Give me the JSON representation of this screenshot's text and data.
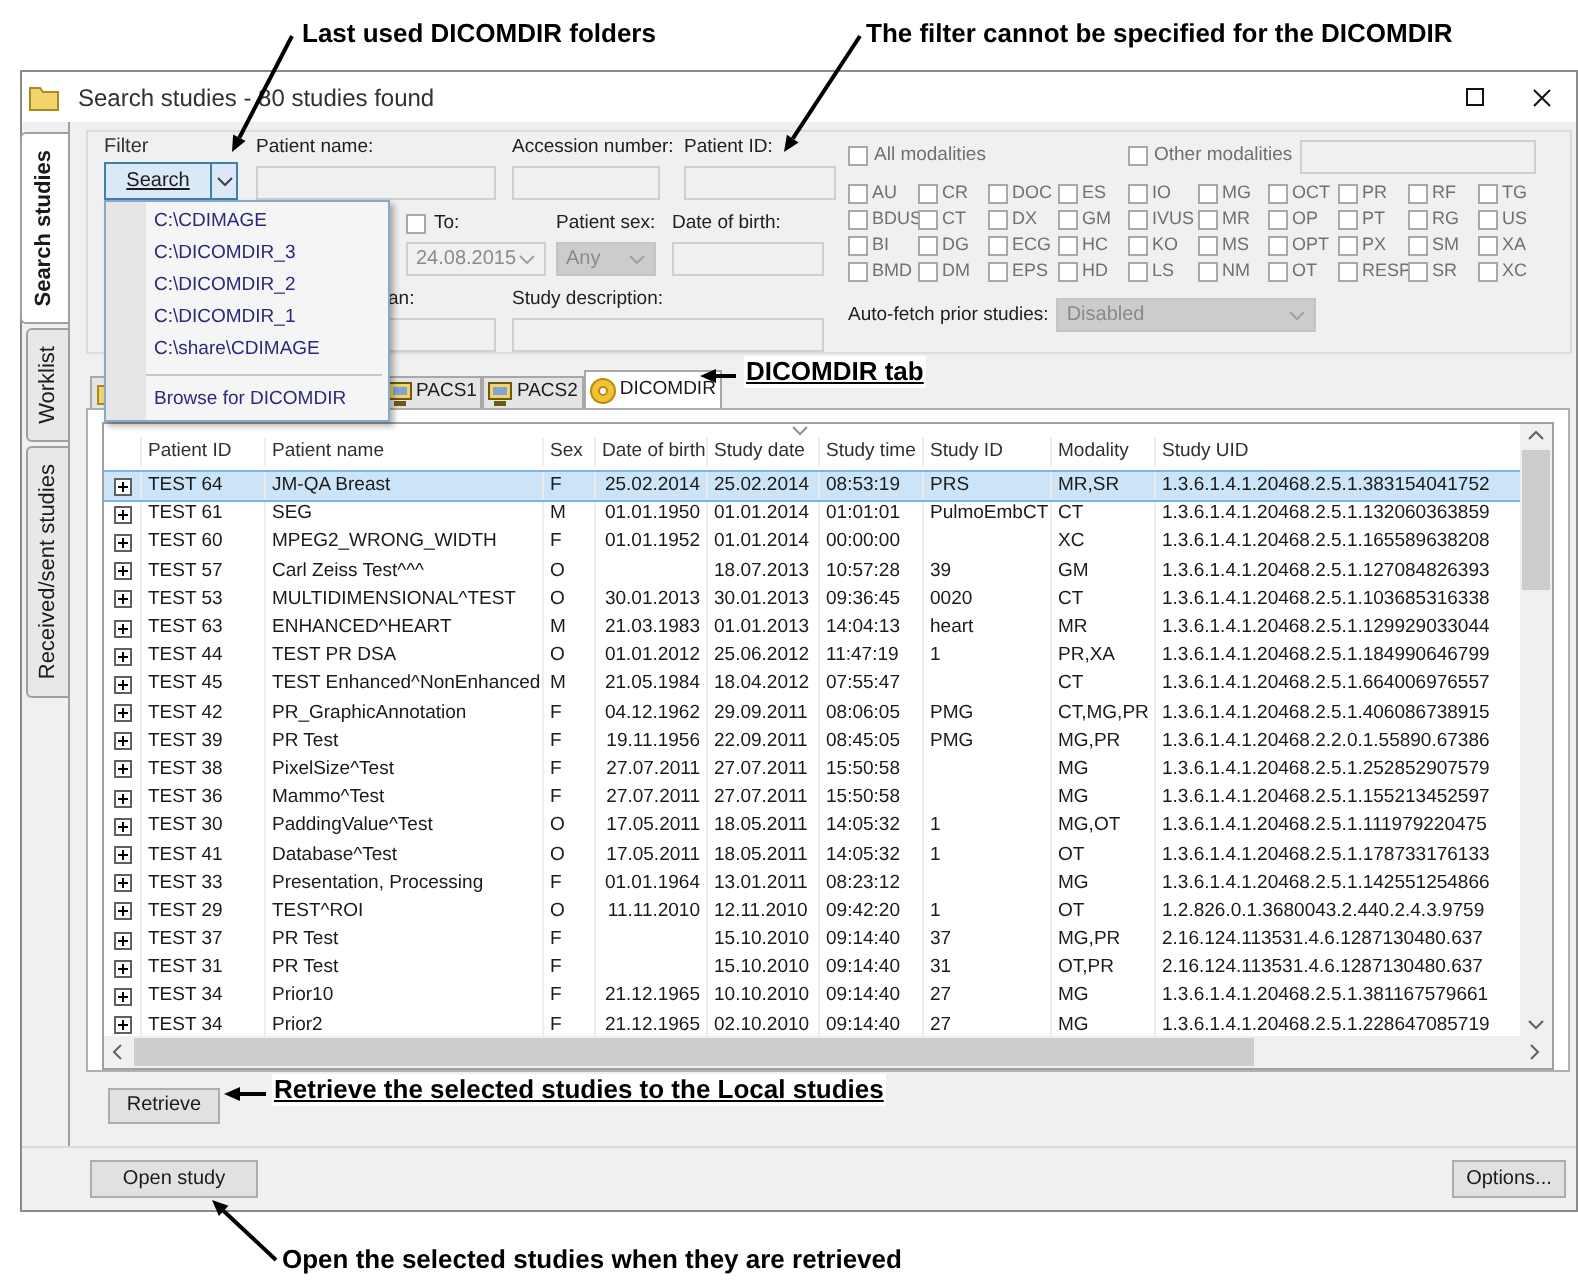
{
  "annotations": [
    {
      "text": "Last used DICOMDIR folders"
    },
    {
      "text": "The filter cannot be specified for the DICOMDIR"
    },
    {
      "text": "DICOMDIR tab"
    },
    {
      "text": "Retrieve the selected studies to the Local studies"
    },
    {
      "text": "Open the selected studies when they are retrieved"
    }
  ],
  "window": {
    "title": "Search studies - 80 studies found"
  },
  "side_tabs": [
    {
      "label": "Search studies",
      "selected": true
    },
    {
      "label": "Worklist",
      "selected": false
    },
    {
      "label": "Received/sent studies",
      "selected": false
    }
  ],
  "filter": {
    "title": "Filter",
    "search_button": "Search",
    "patient_name": {
      "label": "Patient name:"
    },
    "accession_number": {
      "label": "Accession number:"
    },
    "patient_id": {
      "label": "Patient ID:"
    },
    "to": {
      "label": "To:",
      "checked": false,
      "value": "24.08.2015"
    },
    "patient_sex": {
      "label": "Patient sex:",
      "value": "Any",
      "disabled": true
    },
    "date_of_birth": {
      "label": "Date of birth:"
    },
    "field_3": {
      "label": "an:"
    },
    "study_description": {
      "label": "Study description:"
    },
    "all_modalities": {
      "label": "All modalities",
      "checked": false
    },
    "other_modalities": {
      "label": "Other modalities",
      "checked": false
    },
    "modalities": [
      {
        "label": "AU",
        "checked": false
      },
      {
        "label": "CR",
        "checked": false
      },
      {
        "label": "DOC",
        "checked": false
      },
      {
        "label": "ES",
        "checked": false
      },
      {
        "label": "IO",
        "checked": false
      },
      {
        "label": "MG",
        "checked": false
      },
      {
        "label": "OCT",
        "checked": false
      },
      {
        "label": "PR",
        "checked": false
      },
      {
        "label": "RF",
        "checked": false
      },
      {
        "label": "TG",
        "checked": false
      },
      {
        "label": "BDUS",
        "checked": false
      },
      {
        "label": "CT",
        "checked": false
      },
      {
        "label": "DX",
        "checked": false
      },
      {
        "label": "GM",
        "checked": false
      },
      {
        "label": "IVUS",
        "checked": false
      },
      {
        "label": "MR",
        "checked": false
      },
      {
        "label": "OP",
        "checked": false
      },
      {
        "label": "PT",
        "checked": false
      },
      {
        "label": "RG",
        "checked": false
      },
      {
        "label": "US",
        "checked": false
      },
      {
        "label": "BI",
        "checked": false
      },
      {
        "label": "DG",
        "checked": false
      },
      {
        "label": "ECG",
        "checked": false
      },
      {
        "label": "HC",
        "checked": false
      },
      {
        "label": "KO",
        "checked": false
      },
      {
        "label": "MS",
        "checked": false
      },
      {
        "label": "OPT",
        "checked": false
      },
      {
        "label": "PX",
        "checked": false
      },
      {
        "label": "SM",
        "checked": false
      },
      {
        "label": "XA",
        "checked": false
      },
      {
        "label": "BMD",
        "checked": false
      },
      {
        "label": "DM",
        "checked": false
      },
      {
        "label": "EPS",
        "checked": false
      },
      {
        "label": "HD",
        "checked": false
      },
      {
        "label": "LS",
        "checked": false
      },
      {
        "label": "NM",
        "checked": false
      },
      {
        "label": "OT",
        "checked": false
      },
      {
        "label": "RESP",
        "checked": false
      },
      {
        "label": "SR",
        "checked": false
      },
      {
        "label": "XC",
        "checked": false
      }
    ],
    "auto_fetch": {
      "label": "Auto-fetch prior studies:",
      "value": "Disabled",
      "disabled": true
    }
  },
  "folder_menu": {
    "items": [
      {
        "label": "C:\\CDIMAGE"
      },
      {
        "label": "C:\\DICOMDIR_3"
      },
      {
        "label": "C:\\DICOMDIR_2"
      },
      {
        "label": "C:\\DICOMDIR_1"
      },
      {
        "label": "C:\\share\\CDIMAGE"
      }
    ],
    "browse": "Browse for DICOMDIR"
  },
  "source_tabs": [
    {
      "kind": "local",
      "selected": false
    },
    {
      "kind": "pacs",
      "label": "PACS1",
      "selected": false
    },
    {
      "kind": "pacs",
      "label": "PACS2",
      "selected": false
    },
    {
      "kind": "dicomdir",
      "label": "DICOMDIR",
      "selected": true
    }
  ],
  "table": {
    "columns": [
      "Patient ID",
      "Patient name",
      "Sex",
      "Date of birth",
      "Study date",
      "Study time",
      "Study ID",
      "Modality",
      "Study UID"
    ],
    "rows": [
      {
        "selected": true,
        "patient_id": "TEST 64",
        "patient_name": "JM-QA Breast",
        "sex": "F",
        "date_of_birth": "25.02.2014",
        "study_date": "25.02.2014",
        "study_time": "08:53:19",
        "study_id": "PRS",
        "modality": "MR,SR",
        "study_uid": "1.3.6.1.4.1.20468.2.5.1.383154041752"
      },
      {
        "selected": false,
        "patient_id": "TEST 61",
        "patient_name": "SEG",
        "sex": "M",
        "date_of_birth": "01.01.1950",
        "study_date": "01.01.2014",
        "study_time": "01:01:01",
        "study_id": "PulmoEmbCT",
        "modality": "CT",
        "study_uid": "1.3.6.1.4.1.20468.2.5.1.132060363859"
      },
      {
        "selected": false,
        "patient_id": "TEST 60",
        "patient_name": "MPEG2_WRONG_WIDTH",
        "sex": "F",
        "date_of_birth": "01.01.1952",
        "study_date": "01.01.2014",
        "study_time": "00:00:00",
        "modality": "XC",
        "study_uid": "1.3.6.1.4.1.20468.2.5.1.165589638208"
      },
      {
        "selected": false,
        "patient_id": "TEST 57",
        "patient_name": "Carl Zeiss Test^^^",
        "sex": "O",
        "study_date": "18.07.2013",
        "study_time": "10:57:28",
        "study_id": "39",
        "modality": "GM",
        "study_uid": "1.3.6.1.4.1.20468.2.5.1.127084826393"
      },
      {
        "selected": false,
        "patient_id": "TEST 53",
        "patient_name": "MULTIDIMENSIONAL^TEST",
        "sex": "O",
        "date_of_birth": "30.01.2013",
        "study_date": "30.01.2013",
        "study_time": "09:36:45",
        "study_id": "0020",
        "modality": "CT",
        "study_uid": "1.3.6.1.4.1.20468.2.5.1.103685316338"
      },
      {
        "selected": false,
        "patient_id": "TEST 63",
        "patient_name": "ENHANCED^HEART",
        "sex": "M",
        "date_of_birth": "21.03.1983",
        "study_date": "01.01.2013",
        "study_time": "14:04:13",
        "study_id": "heart",
        "modality": "MR",
        "study_uid": "1.3.6.1.4.1.20468.2.5.1.129929033044"
      },
      {
        "selected": false,
        "patient_id": "TEST 44",
        "patient_name": "TEST PR DSA",
        "sex": "O",
        "date_of_birth": "01.01.2012",
        "study_date": "25.06.2012",
        "study_time": "11:47:19",
        "study_id": "1",
        "modality": "PR,XA",
        "study_uid": "1.3.6.1.4.1.20468.2.5.1.184990646799"
      },
      {
        "selected": false,
        "patient_id": "TEST 45",
        "patient_name": "TEST Enhanced^NonEnhanced",
        "sex": "M",
        "date_of_birth": "21.05.1984",
        "study_date": "18.04.2012",
        "study_time": "07:55:47",
        "modality": "CT",
        "study_uid": "1.3.6.1.4.1.20468.2.5.1.664006976557"
      },
      {
        "selected": false,
        "patient_id": "TEST 42",
        "patient_name": "PR_GraphicAnnotation",
        "sex": "F",
        "date_of_birth": "04.12.1962",
        "study_date": "29.09.2011",
        "study_time": "08:06:05",
        "study_id": "PMG",
        "modality": "CT,MG,PR",
        "study_uid": "1.3.6.1.4.1.20468.2.5.1.406086738915"
      },
      {
        "selected": false,
        "patient_id": "TEST 39",
        "patient_name": "PR Test",
        "sex": "F",
        "date_of_birth": "19.11.1956",
        "study_date": "22.09.2011",
        "study_time": "08:45:05",
        "study_id": "PMG",
        "modality": "MG,PR",
        "study_uid": "1.3.6.1.4.1.20468.2.2.0.1.55890.67386"
      },
      {
        "selected": false,
        "patient_id": "TEST 38",
        "patient_name": "PixelSize^Test",
        "sex": "F",
        "date_of_birth": "27.07.2011",
        "study_date": "27.07.2011",
        "study_time": "15:50:58",
        "modality": "MG",
        "study_uid": "1.3.6.1.4.1.20468.2.5.1.252852907579"
      },
      {
        "selected": false,
        "patient_id": "TEST 36",
        "patient_name": "Mammo^Test",
        "sex": "F",
        "date_of_birth": "27.07.2011",
        "study_date": "27.07.2011",
        "study_time": "15:50:58",
        "modality": "MG",
        "study_uid": "1.3.6.1.4.1.20468.2.5.1.155213452597"
      },
      {
        "selected": false,
        "patient_id": "TEST 30",
        "patient_name": "PaddingValue^Test",
        "sex": "O",
        "date_of_birth": "17.05.2011",
        "study_date": "18.05.2011",
        "study_time": "14:05:32",
        "study_id": "1",
        "modality": "MG,OT",
        "study_uid": "1.3.6.1.4.1.20468.2.5.1.111979220475"
      },
      {
        "selected": false,
        "patient_id": "TEST 41",
        "patient_name": "Database^Test",
        "sex": "O",
        "date_of_birth": "17.05.2011",
        "study_date": "18.05.2011",
        "study_time": "14:05:32",
        "study_id": "1",
        "modality": "OT",
        "study_uid": "1.3.6.1.4.1.20468.2.5.1.178733176133"
      },
      {
        "selected": false,
        "patient_id": "TEST 33",
        "patient_name": "Presentation, Processing",
        "sex": "F",
        "date_of_birth": "01.01.1964",
        "study_date": "13.01.2011",
        "study_time": "08:23:12",
        "modality": "MG",
        "study_uid": "1.3.6.1.4.1.20468.2.5.1.142551254866"
      },
      {
        "selected": false,
        "patient_id": "TEST 29",
        "patient_name": "TEST^ROI",
        "sex": "O",
        "date_of_birth": "11.11.2010",
        "study_date": "12.11.2010",
        "study_time": "09:42:20",
        "study_id": "1",
        "modality": "OT",
        "study_uid": "1.2.826.0.1.3680043.2.440.2.4.3.9759"
      },
      {
        "selected": false,
        "patient_id": "TEST 37",
        "patient_name": "PR Test",
        "sex": "F",
        "study_date": "15.10.2010",
        "study_time": "09:14:40",
        "study_id": "37",
        "modality": "MG,PR",
        "study_uid": "2.16.124.113531.4.6.1287130480.637"
      },
      {
        "selected": false,
        "patient_id": "TEST 31",
        "patient_name": "PR Test",
        "sex": "F",
        "study_date": "15.10.2010",
        "study_time": "09:14:40",
        "study_id": "31",
        "modality": "OT,PR",
        "study_uid": "2.16.124.113531.4.6.1287130480.637"
      },
      {
        "selected": false,
        "patient_id": "TEST 34",
        "patient_name": "Prior10",
        "sex": "F",
        "date_of_birth": "21.12.1965",
        "study_date": "10.10.2010",
        "study_time": "09:14:40",
        "study_id": "27",
        "modality": "MG",
        "study_uid": "1.3.6.1.4.1.20468.2.5.1.381167579661"
      },
      {
        "selected": false,
        "patient_id": "TEST 34",
        "patient_name": "Prior2",
        "sex": "F",
        "date_of_birth": "21.12.1965",
        "study_date": "02.10.2010",
        "study_time": "09:14:40",
        "study_id": "27",
        "modality": "MG",
        "study_uid": "1.3.6.1.4.1.20468.2.5.1.228647085719"
      }
    ]
  },
  "retrieve_button": "Retrieve",
  "open_study_button": "Open study",
  "options_button": "Options..."
}
